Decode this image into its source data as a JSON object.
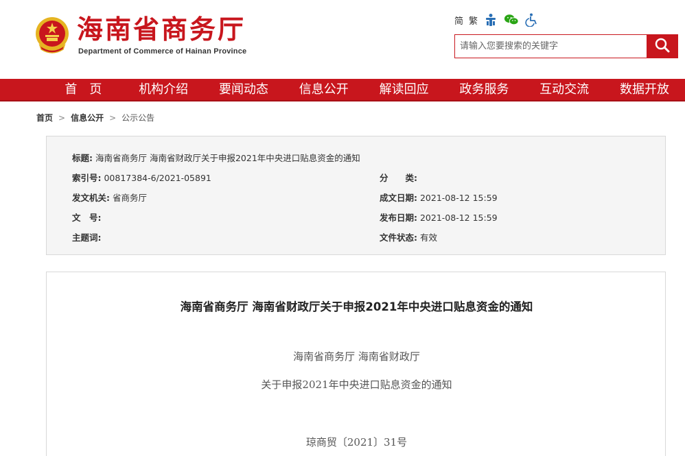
{
  "header": {
    "title": "海南省商务厅",
    "subtitle": "Department of Commerce of Hainan Province",
    "tools": {
      "simplified": "简",
      "traditional": "繁"
    },
    "search": {
      "placeholder": "请输入您要搜索的关键字"
    }
  },
  "nav": {
    "items": [
      {
        "label": "首　页"
      },
      {
        "label": "机构介绍"
      },
      {
        "label": "要闻动态"
      },
      {
        "label": "信息公开"
      },
      {
        "label": "解读回应"
      },
      {
        "label": "政务服务"
      },
      {
        "label": "互动交流"
      },
      {
        "label": "数据开放"
      }
    ]
  },
  "breadcrumb": {
    "home": "首页",
    "sep": ">",
    "section": "信息公开",
    "current": "公示公告"
  },
  "info": {
    "title_label": "标题:",
    "title_value": "海南省商务厅 海南省财政厅关于申报2021年中央进口贴息资金的通知",
    "index_label": "索引号:",
    "index_value": "00817384-6/2021-05891",
    "category_label": "分　　类:",
    "category_value": "",
    "issuer_label": "发文机关:",
    "issuer_value": "省商务厅",
    "created_label": "成文日期:",
    "created_value": "2021-08-12 15:59",
    "docno_label": "文　号:",
    "docno_value": "",
    "published_label": "发布日期:",
    "published_value": "2021-08-12 15:59",
    "keywords_label": "主题词:",
    "keywords_value": "",
    "status_label": "文件状态:",
    "status_value": "有效"
  },
  "article": {
    "title": "海南省商务厅 海南省财政厅关于申报2021年中央进口贴息资金的通知",
    "line1": "海南省商务厅  海南省财政厅",
    "line2": "关于申报2021年中央进口贴息资金的通知",
    "docno": "琼商贸〔2021〕31号"
  },
  "colors": {
    "brand_red": "#c8161d"
  }
}
